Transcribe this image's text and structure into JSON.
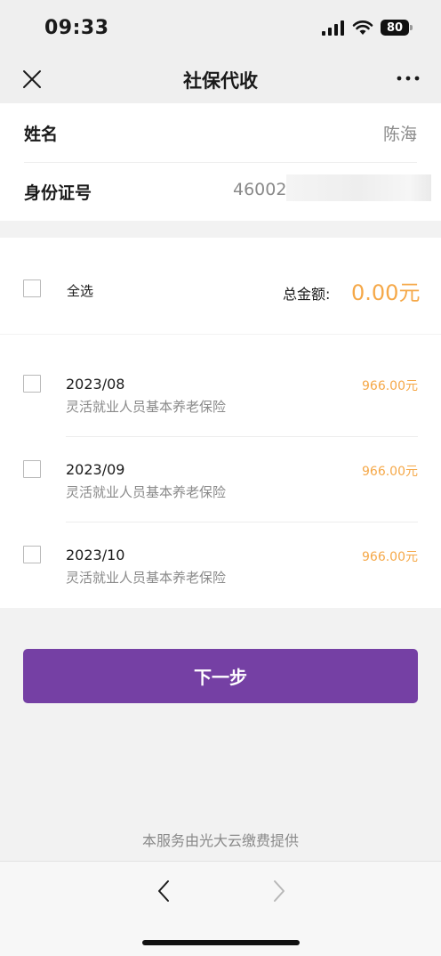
{
  "status_bar": {
    "time": "09:33",
    "battery": "80"
  },
  "nav": {
    "title": "社保代收"
  },
  "info": {
    "name_label": "姓名",
    "name_value": "陈海",
    "id_label": "身份证号",
    "id_value": "46002"
  },
  "selection": {
    "select_all_label": "全选",
    "total_label": "总金额:",
    "total_value": "0.00元",
    "items": [
      {
        "date": "2023/08",
        "desc": "灵活就业人员基本养老保险",
        "amount": "966.00元"
      },
      {
        "date": "2023/09",
        "desc": "灵活就业人员基本养老保险",
        "amount": "966.00元"
      },
      {
        "date": "2023/10",
        "desc": "灵活就业人员基本养老保险",
        "amount": "966.00元"
      }
    ]
  },
  "next_button_label": "下一步",
  "footer_note": "本服务由光大云缴费提供",
  "colors": {
    "accent": "#7540a4",
    "amount": "#f5a848"
  }
}
